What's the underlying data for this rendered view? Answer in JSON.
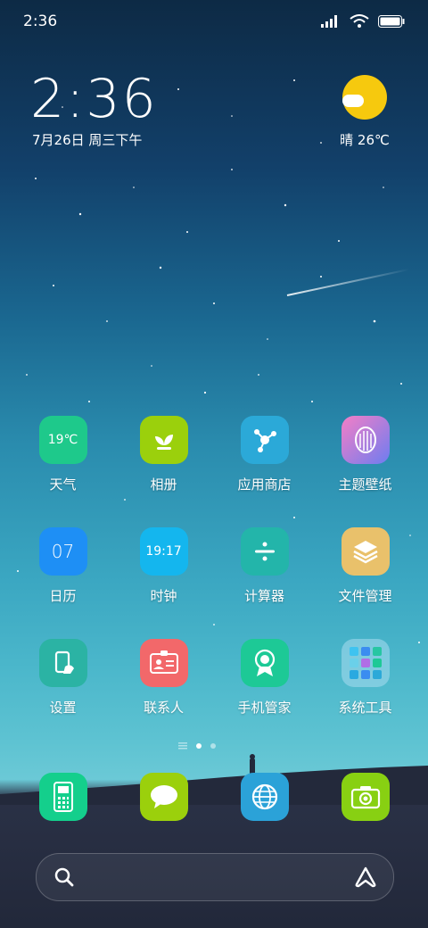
{
  "status": {
    "time": "2:36"
  },
  "clock": {
    "time": "2:36",
    "date": "7月26日 周三下午"
  },
  "weather": {
    "text": "晴 26℃"
  },
  "apps": [
    [
      {
        "label": "天气",
        "icon": "weather-icon",
        "badge": "19℃",
        "color": "#1ec98b"
      },
      {
        "label": "相册",
        "icon": "gallery-sprout-icon",
        "color": "#9bd00c"
      },
      {
        "label": "应用商店",
        "icon": "app-store-icon",
        "color": "#2ba9d8"
      },
      {
        "label": "主题壁纸",
        "icon": "themes-icon",
        "color": "#9b6be8"
      }
    ],
    [
      {
        "label": "日历",
        "icon": "calendar-icon",
        "badge": "07",
        "color": "#1e8ff5"
      },
      {
        "label": "时钟",
        "icon": "clock-icon",
        "badge": "19:17",
        "color": "#14b6ee"
      },
      {
        "label": "计算器",
        "icon": "calculator-icon",
        "color": "#23b5aa"
      },
      {
        "label": "文件管理",
        "icon": "file-manager-icon",
        "color": "#e9c16b"
      }
    ],
    [
      {
        "label": "设置",
        "icon": "settings-icon",
        "color": "#2bb3a4"
      },
      {
        "label": "联系人",
        "icon": "contacts-icon",
        "color": "#f2686a"
      },
      {
        "label": "手机管家",
        "icon": "security-icon",
        "color": "#1dc996"
      },
      {
        "label": "系统工具",
        "icon": "system-tools-folder-icon",
        "color": "#5a9ad0"
      }
    ]
  ],
  "dock": [
    {
      "icon": "phone-icon",
      "color": "#14cf8c"
    },
    {
      "icon": "messages-icon",
      "color": "#9bd00c"
    },
    {
      "icon": "browser-icon",
      "color": "#2ba2d8"
    },
    {
      "icon": "camera-icon",
      "color": "#88d012"
    }
  ]
}
